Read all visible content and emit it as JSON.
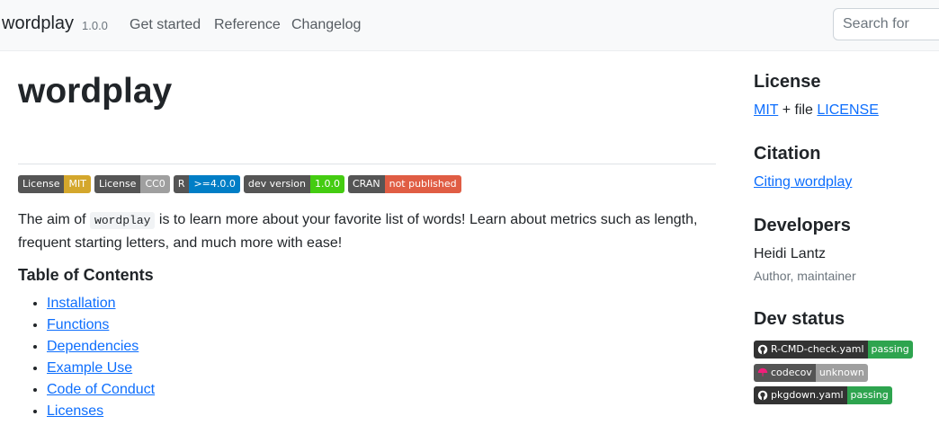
{
  "navbar": {
    "brand": "wordplay",
    "version": "1.0.0",
    "links": [
      "Get started",
      "Reference",
      "Changelog"
    ],
    "search_placeholder": "Search for"
  },
  "main": {
    "title": "wordplay",
    "badges": [
      {
        "left": "License",
        "right": "MIT",
        "color": "#d4a72c"
      },
      {
        "left": "License",
        "right": "CC0",
        "color": "#9f9f9f"
      },
      {
        "left": "R",
        "right": ">=4.0.0",
        "color": "#007ec6"
      },
      {
        "left": "dev version",
        "right": "1.0.0",
        "color": "#4c1"
      },
      {
        "left": "CRAN",
        "right": "not published",
        "color": "#e05d44"
      }
    ],
    "intro_before": "The aim of ",
    "intro_code": "wordplay",
    "intro_after": " is to learn more about your favorite list of words! Learn about metrics such as length, frequent starting letters, and much more with ease!",
    "toc_title": "Table of Contents",
    "toc_items": [
      "Installation",
      "Functions",
      "Dependencies",
      "Example Use",
      "Code of Conduct",
      "Licenses"
    ]
  },
  "sidebar": {
    "license_heading": "License",
    "license_mit": "MIT",
    "license_plus": " + file ",
    "license_file": "LICENSE",
    "citation_heading": "Citation",
    "citation_link": "Citing wordplay",
    "developers_heading": "Developers",
    "developer_name": "Heidi Lantz",
    "developer_role": "Author, maintainer",
    "devstatus_heading": "Dev status",
    "status_badges": [
      {
        "left": "R-CMD-check.yaml",
        "right": "passing",
        "color": "#2ea44f",
        "icon": "github-icon"
      },
      {
        "left": "codecov",
        "right": "unknown",
        "color": "#9f9f9f",
        "icon": "codecov-umbrella-icon"
      },
      {
        "left": "pkgdown.yaml",
        "right": "passing",
        "color": "#2ea44f",
        "icon": "github-icon"
      }
    ]
  }
}
